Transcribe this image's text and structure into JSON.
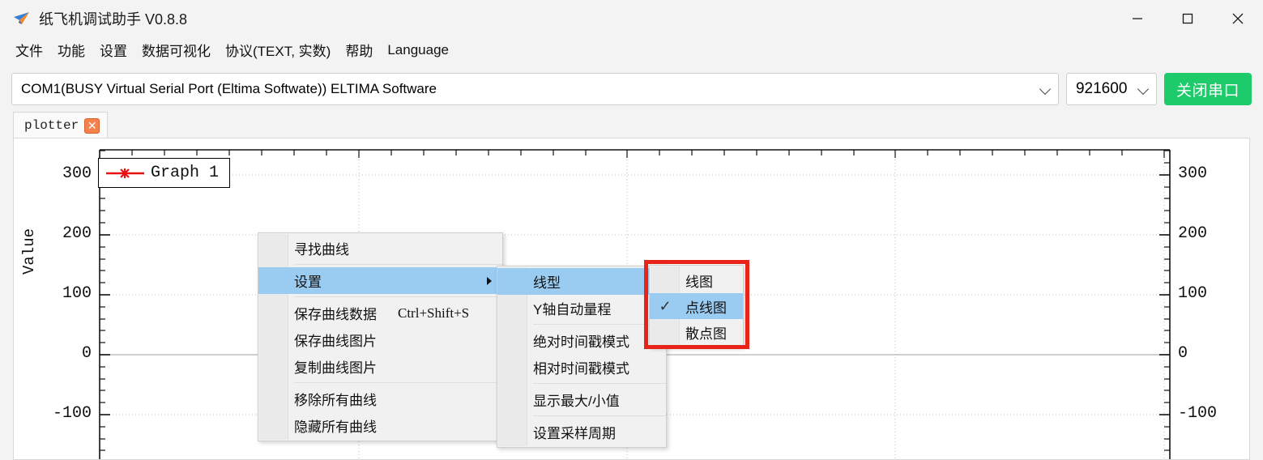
{
  "window": {
    "title": "纸飞机调试助手 V0.8.8",
    "icon": "paper-plane-icon",
    "minimize": "—",
    "maximize": "▢",
    "close": "✕"
  },
  "menubar": {
    "items": [
      {
        "label": "文件"
      },
      {
        "label": "功能"
      },
      {
        "label": "设置"
      },
      {
        "label": "数据可视化"
      },
      {
        "label": "协议(TEXT, 实数)"
      },
      {
        "label": "帮助"
      },
      {
        "label": "Language"
      }
    ]
  },
  "toolbar": {
    "port_value": "COM1(BUSY  Virtual Serial Port (Eltima Softwate)) ELTIMA Software",
    "baud_value": "921600",
    "close_port_label": "关闭串口",
    "accent_green": "#1ecb6a"
  },
  "tabs": [
    {
      "label": "plotter",
      "close": "✕",
      "active": true
    }
  ],
  "chart_data": {
    "type": "line",
    "title": "",
    "xlabel": "",
    "ylabel": "Value",
    "legend": [
      {
        "name": "Graph 1",
        "color": "#e81010",
        "marker": "star",
        "style": "line-with-markers"
      }
    ],
    "legend_position": "top-left",
    "grid": true,
    "y_ticks_left": [
      "300",
      "200",
      "100",
      "0",
      "-100"
    ],
    "y_ticks_right": [
      "300",
      "200",
      "100",
      "0",
      "-100"
    ],
    "yvalues": [
      300,
      200,
      100,
      0,
      -100
    ],
    "ylim": [
      -160,
      360
    ],
    "minor_ticks_per_interval": 5,
    "x": [],
    "series": [
      {
        "name": "Graph 1",
        "values": []
      }
    ],
    "x_gridlines": 4,
    "note": "Empty plot: no data points drawn in the visible area"
  },
  "context_menu_1": {
    "items": [
      {
        "label": "寻找曲线",
        "accel": "",
        "arrow": false,
        "selected": false,
        "checked": false
      },
      {
        "sep": true
      },
      {
        "label": "设置",
        "accel": "",
        "arrow": true,
        "selected": true,
        "checked": false
      },
      {
        "sep": true
      },
      {
        "label": "保存曲线数据",
        "accel": "Ctrl+Shift+S",
        "arrow": false,
        "selected": false,
        "checked": false
      },
      {
        "label": "保存曲线图片",
        "accel": "",
        "arrow": false,
        "selected": false,
        "checked": false
      },
      {
        "label": "复制曲线图片",
        "accel": "",
        "arrow": false,
        "selected": false,
        "checked": false
      },
      {
        "sep": true
      },
      {
        "label": "移除所有曲线",
        "accel": "",
        "arrow": false,
        "selected": false,
        "checked": false
      },
      {
        "label": "隐藏所有曲线",
        "accel": "",
        "arrow": false,
        "selected": false,
        "checked": false
      }
    ]
  },
  "context_menu_2": {
    "items": [
      {
        "label": "线型",
        "arrow": true,
        "selected": true,
        "checked": false
      },
      {
        "label": "Y轴自动量程",
        "arrow": false,
        "selected": false,
        "checked": false
      },
      {
        "sep": true
      },
      {
        "label": "绝对时间戳模式",
        "arrow": false,
        "selected": false,
        "checked": false
      },
      {
        "label": "相对时间戳模式",
        "arrow": false,
        "selected": false,
        "checked": false
      },
      {
        "sep": true
      },
      {
        "label": "显示最大/小值",
        "arrow": false,
        "selected": false,
        "checked": false
      },
      {
        "sep": true
      },
      {
        "label": "设置采样周期",
        "arrow": false,
        "selected": false,
        "checked": false
      }
    ]
  },
  "context_menu_3": {
    "items": [
      {
        "label": "线图",
        "selected": false,
        "checked": false
      },
      {
        "label": "点线图",
        "selected": true,
        "checked": true
      },
      {
        "label": "散点图",
        "selected": false,
        "checked": false
      }
    ],
    "check_glyph": "✓",
    "highlight_color": "#9acbf0",
    "annotation_color": "#e8231a"
  }
}
